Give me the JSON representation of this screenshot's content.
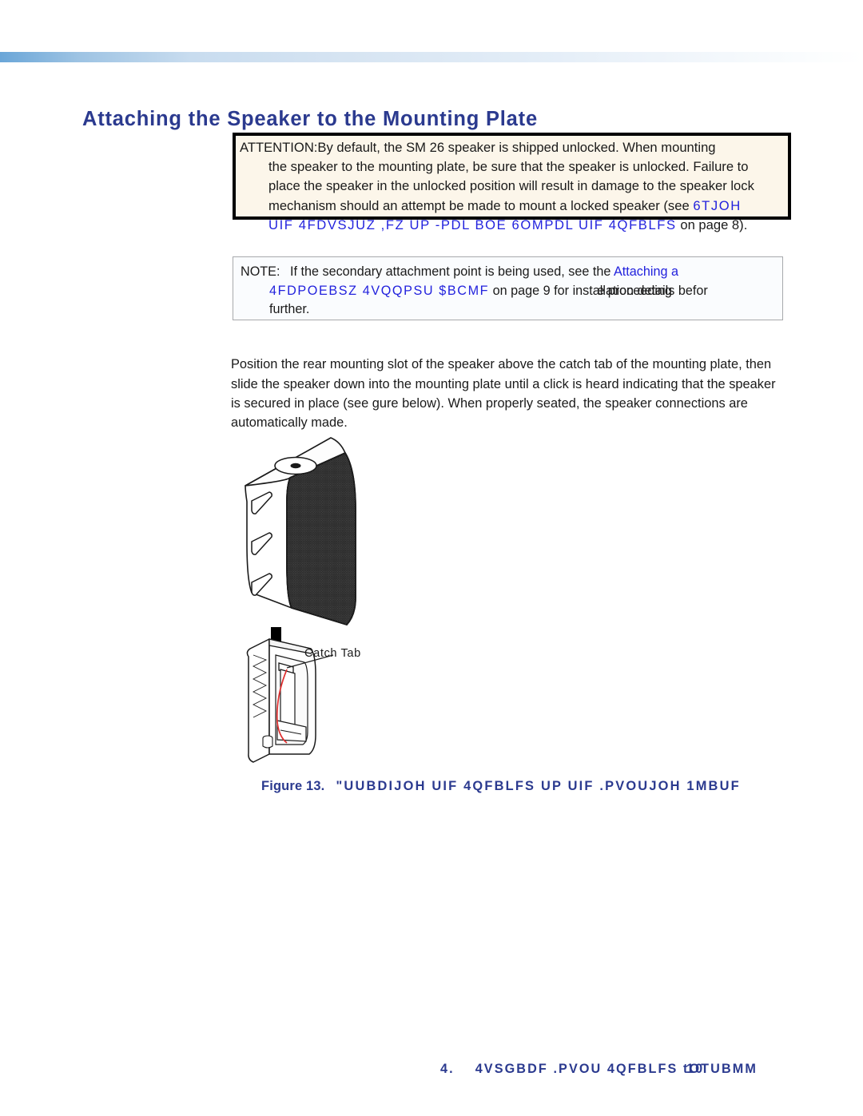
{
  "document": {
    "page_title": "Attaching the Speaker to the Mounting Plate",
    "accent_color": "#2b3a8f",
    "xref_color": "#2222dd",
    "header_band_color": "#6aa6d8"
  },
  "attention": {
    "label": "ATTENTION:",
    "line1": "By default, the SM 26 speaker is shipped unlocked. When mounting",
    "line2": "the speaker to the mounting plate, be sure that the speaker is unlocked. Failure to",
    "line3": "place the speaker in the unlocked position will result in damage to the speaker lock",
    "line4": "mechanism should an attempt be made to mount a locked speaker (see",
    "xref_line4": "6TJOH",
    "xref_line5": "UIF 4FDVSJUZ ,FZ UP -PDL BOE 6OMPDL UIF 4QFBLFS",
    "line5_tail": "on page 8)."
  },
  "note": {
    "label": "NOTE:",
    "line1": "If the secondary attachment point is being used, see the",
    "xref_line1": "Attaching a",
    "xref_line2": "4FDPOEBSZ 4VQQPSU $BCMF",
    "line2_mid": "on page 9 for ins",
    "line2_overlap_a": "tallation details befor",
    "line2_overlap_b": "e proceeding",
    "line3": "further."
  },
  "body": {
    "line1": "Position the rear mounting slot of the speaker above the catch tab of the mounting plate,",
    "line2": "then slide the speaker down into the mounting plate until a click is heard indicating that",
    "line3": "the speaker is secured in place (see  gure below). When properly seated, the speaker",
    "line4": "connections are automatically made."
  },
  "figure": {
    "callout_catch_tab": "Catch Tab",
    "caption_number": "Figure 13.",
    "caption_text": "\"UUBDIJOH UIF 4QFBLFS UP UIF .PVOUJOH 1MBUF"
  },
  "footer": {
    "prefix": "4.",
    "title": "4VSGBDF .PVOU 4QFBLFS",
    "bullet_a": "t",
    "bullet_b": "10",
    "tail": "OTUBMM"
  }
}
